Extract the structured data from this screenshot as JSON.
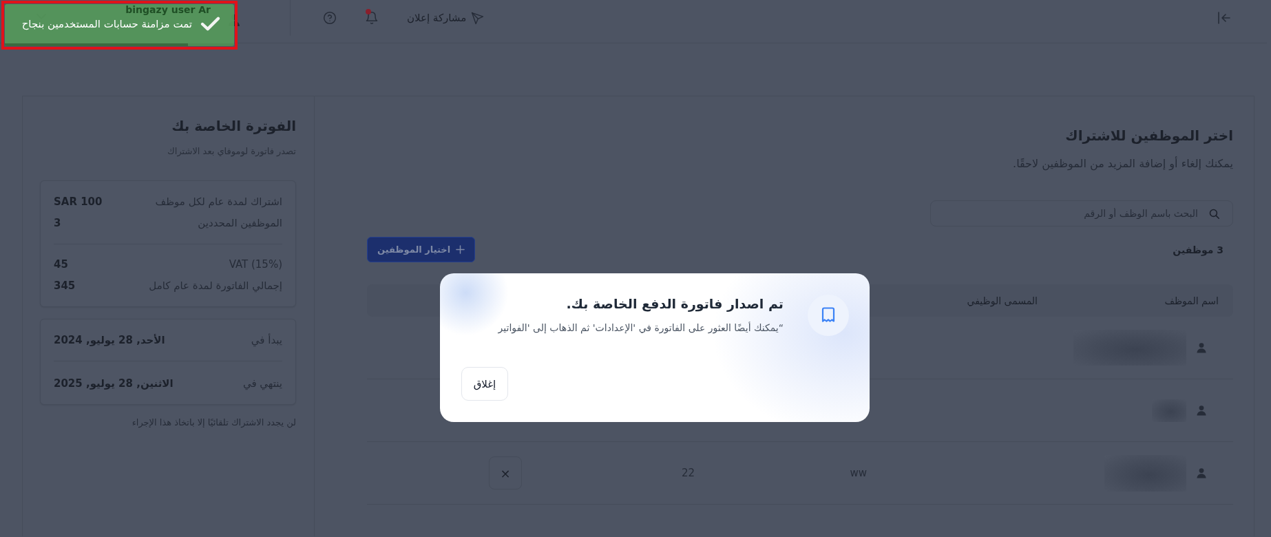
{
  "topbar": {
    "share_link": "مشاركة إعلان",
    "notifications": {
      "unread": true
    },
    "user": {
      "name": "bingazy user Ar"
    }
  },
  "toast": {
    "message": "تمت مزامنة حسابات المستخدمين بنجاح",
    "level": 0.8,
    "highlighted": true
  },
  "employees": {
    "title": "اختر الموظفين للاشتراك",
    "subtitle": "يمكنك إلغاء أو إضافة المزيد من الموظفين لاحقًا.",
    "search": {
      "placeholder": "البحث باسم الوظف أو الرقم"
    },
    "count": "3 موظفين",
    "add_button": "اختيار الموظفين",
    "table": {
      "columns": [
        "اسم الموظف",
        "المسمى الوظيفي"
      ],
      "rows": [
        {
          "kind": "covered"
        },
        {
          "kind": "covered"
        },
        {
          "kind": "full",
          "job_title": "ww",
          "column_3": "22",
          "remove": "×"
        }
      ]
    }
  },
  "invoice": {
    "title": "الفوترة الخاصة بك",
    "subtitle": "تصدر فاتورة لوموفاي بعد الاشتراك",
    "summary_groups": [
      {
        "rows": [
          {
            "label": "اشتراك لمدة عام لكل موظف",
            "value": "SAR 100"
          },
          {
            "label": "الموظفين المحددين",
            "value": "3"
          }
        ]
      },
      {
        "rows": [
          {
            "label": "VAT (15%)",
            "value": "45"
          },
          {
            "label": "إجمالي الفاتورة لمدة عام كامل",
            "value": "345"
          }
        ]
      }
    ],
    "period": [
      {
        "label": "يبدأ في",
        "value": "الأحد, 28 يوليو, 2024"
      },
      {
        "label": "ينتهي في",
        "value": "الاثنين, 28 يوليو, 2025"
      }
    ],
    "note": "لن يجدد الاشتراك تلقائيًا إلا باتخاذ هذا الإجراء"
  },
  "dialog": {
    "title": "تم اصدار فاتورة الدفع الخاصة بك.",
    "message": "“يمكنك أيضًا العثور على الفاتورة في 'الإعدادات' ثم الذهاب إلى 'الفواتير",
    "close_button": "إغلاق"
  }
}
